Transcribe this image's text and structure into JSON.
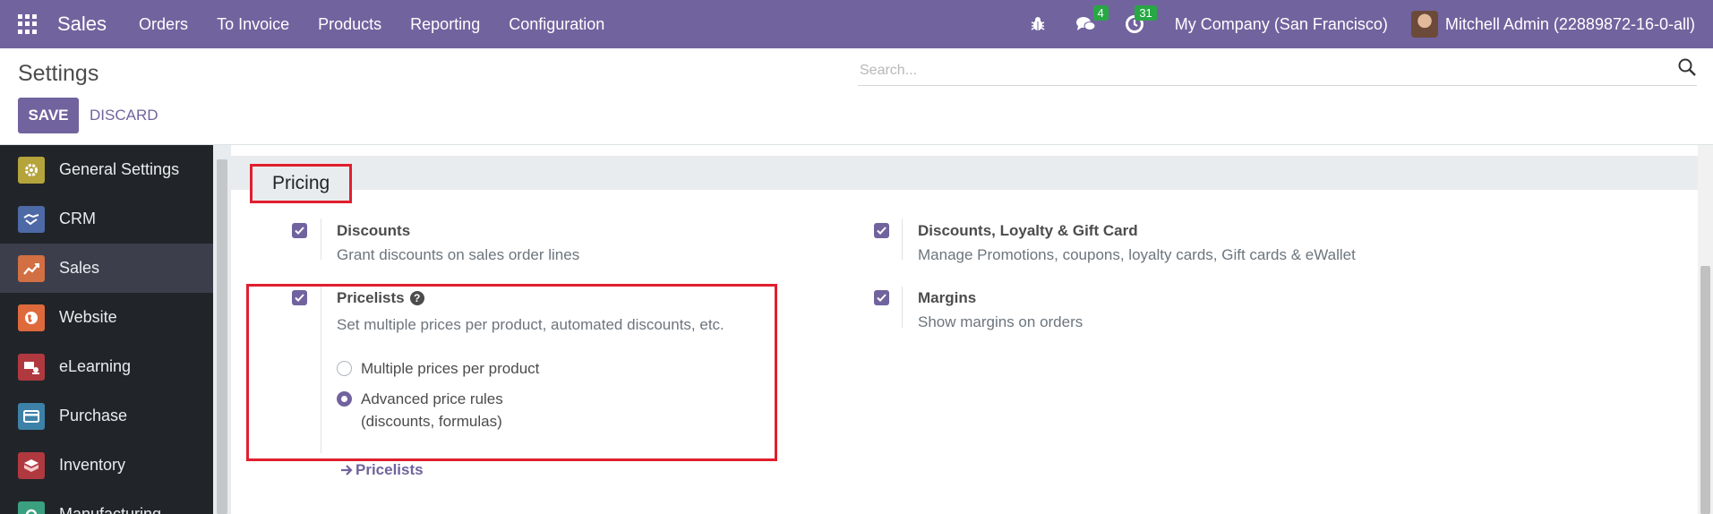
{
  "navbar": {
    "app_name": "Sales",
    "menu": [
      "Orders",
      "To Invoice",
      "Products",
      "Reporting",
      "Configuration"
    ],
    "chat_count": "4",
    "activity_count": "31",
    "company": "My Company (San Francisco)",
    "user": "Mitchell Admin (22889872-16-0-all)"
  },
  "control": {
    "breadcrumb": "Settings",
    "save_label": "SAVE",
    "discard_label": "DISCARD",
    "search_placeholder": "Search..."
  },
  "sidebar": {
    "items": [
      {
        "label": "General Settings",
        "color": "#b5a33b"
      },
      {
        "label": "CRM",
        "color": "#4d6aa6"
      },
      {
        "label": "Sales",
        "color": "#d26f43"
      },
      {
        "label": "Website",
        "color": "#de6a3c"
      },
      {
        "label": "eLearning",
        "color": "#b0393f"
      },
      {
        "label": "Purchase",
        "color": "#3d81a8"
      },
      {
        "label": "Inventory",
        "color": "#b0393f"
      },
      {
        "label": "Manufacturing",
        "color": "#3aa07f"
      }
    ],
    "active_index": 2
  },
  "section": {
    "title": "Pricing"
  },
  "settings": {
    "discounts": {
      "title": "Discounts",
      "desc": "Grant discounts on sales order lines"
    },
    "loyalty": {
      "title": "Discounts, Loyalty & Gift Card",
      "desc": "Manage Promotions, coupons, loyalty cards, Gift cards & eWallet"
    },
    "pricelists": {
      "title": "Pricelists",
      "desc": "Set multiple prices per product, automated discounts, etc.",
      "option_multiple": "Multiple prices per product",
      "option_advanced_line1": "Advanced price rules",
      "option_advanced_line2": "(discounts, formulas)",
      "selected": "advanced",
      "link": "Pricelists"
    },
    "margins": {
      "title": "Margins",
      "desc": "Show margins on orders"
    }
  },
  "colors": {
    "brand": "#71639e",
    "highlight": "#e01f2e"
  }
}
